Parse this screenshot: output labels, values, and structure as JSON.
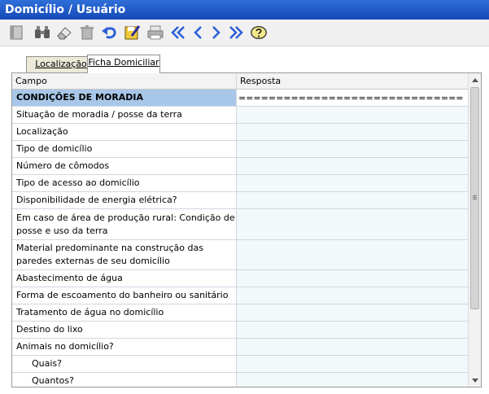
{
  "window": {
    "title": "Domicílio / Usuário"
  },
  "toolbar": {
    "buttons": [
      {
        "icon": "new-record-icon"
      },
      {
        "icon": "binoculars-icon"
      },
      {
        "icon": "eraser-icon"
      },
      {
        "icon": "trash-icon"
      },
      {
        "icon": "undo-icon"
      },
      {
        "icon": "edit-save-icon"
      },
      {
        "icon": "printer-icon"
      },
      {
        "icon": "first-record-icon"
      },
      {
        "icon": "previous-record-icon"
      },
      {
        "icon": "next-record-icon"
      },
      {
        "icon": "last-record-icon"
      },
      {
        "icon": "help-icon"
      }
    ],
    "colors": {
      "nav_arrows": "#2b5fd9",
      "title_bar": "#1c55c4"
    }
  },
  "tabs": [
    {
      "label": "Localização",
      "active": false
    },
    {
      "label": "Ficha Domiciliar",
      "active": true
    }
  ],
  "grid": {
    "columns": {
      "campo": "Campo",
      "resposta": "Resposta"
    },
    "rows": [
      {
        "campo": "CONDIÇÕES DE MORADIA",
        "resposta": "=============================="
      },
      {
        "campo": "Situação de moradia / posse da terra",
        "resposta": ""
      },
      {
        "campo": "Localização",
        "resposta": ""
      },
      {
        "campo": "Tipo de domicílio",
        "resposta": ""
      },
      {
        "campo": "Número de cômodos",
        "resposta": ""
      },
      {
        "campo": "Tipo de acesso ao domicílio",
        "resposta": ""
      },
      {
        "campo": "Disponibilidade de energia elétrica?",
        "resposta": ""
      },
      {
        "campo": "Em caso de área de produção rural: Condição de posse e uso da terra",
        "resposta": ""
      },
      {
        "campo": "Material predominante na construção das paredes externas de seu domicílio",
        "resposta": ""
      },
      {
        "campo": "Abastecimento de água",
        "resposta": ""
      },
      {
        "campo": "Forma de escoamento do banheiro ou sanitário",
        "resposta": ""
      },
      {
        "campo": "Tratamento de água no domicílio",
        "resposta": ""
      },
      {
        "campo": "Destino do lixo",
        "resposta": ""
      },
      {
        "campo": "Animais no domicílio?",
        "resposta": ""
      },
      {
        "campo": "Quais?",
        "resposta": ""
      },
      {
        "campo": "Quantos?",
        "resposta": ""
      }
    ],
    "section_color": "#a8c7e8",
    "answer_bg": "#f3f8fb"
  }
}
